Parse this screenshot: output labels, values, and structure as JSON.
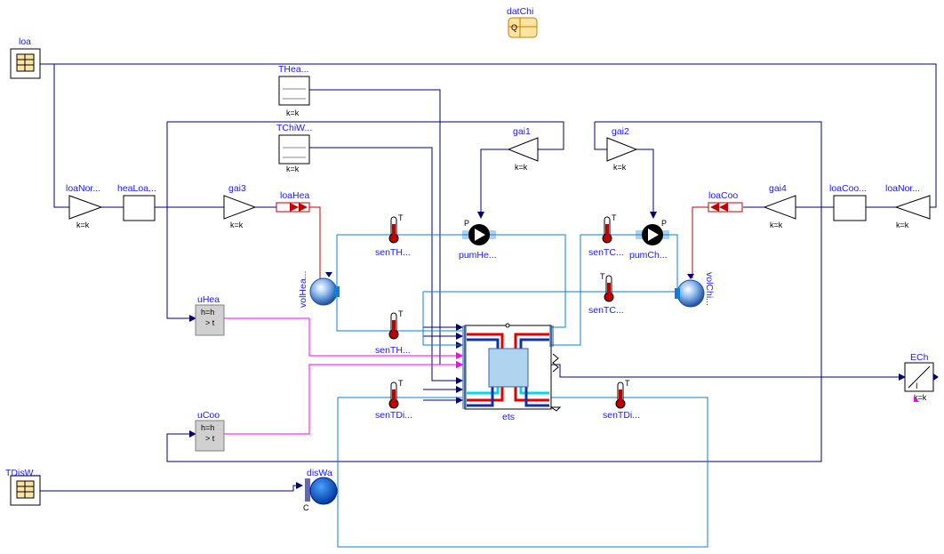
{
  "components": {
    "datChi": "datChi",
    "loa": "loa",
    "THea": "THea...",
    "TChiW": "TChiW...",
    "gai1": "gai1",
    "gai2": "gai2",
    "gai3": "gai3",
    "gai4": "gai4",
    "loaNorHea": "loaNor...",
    "heaLoa": "heaLoa...",
    "loaHea": "loaHea",
    "loaCoo": "loaCoo",
    "loaCooRev": "loaCoo...",
    "loaNorCoo": "loaNor...",
    "senTHeaIn": "senTH...",
    "senTHeaOut": "senTH...",
    "pumHea": "pumHe...",
    "senTChiIn": "senTC...",
    "senTChiOut": "senTC...",
    "pumChi": "pumCh...",
    "volHea": "volHea...",
    "volChi": "volChi...",
    "uHea": "uHea",
    "uCoo": "uCoo",
    "ets": "ets",
    "senTDisIn": "senTDi...",
    "senTDisOut": "senTDi...",
    "ECh": "ECh",
    "TDisW": "TDisW...",
    "disWat": "disWa"
  },
  "params": {
    "k": "k=k",
    "h": "h=h",
    "gt": "> t",
    "T": "T",
    "P": "P",
    "C": "C"
  }
}
